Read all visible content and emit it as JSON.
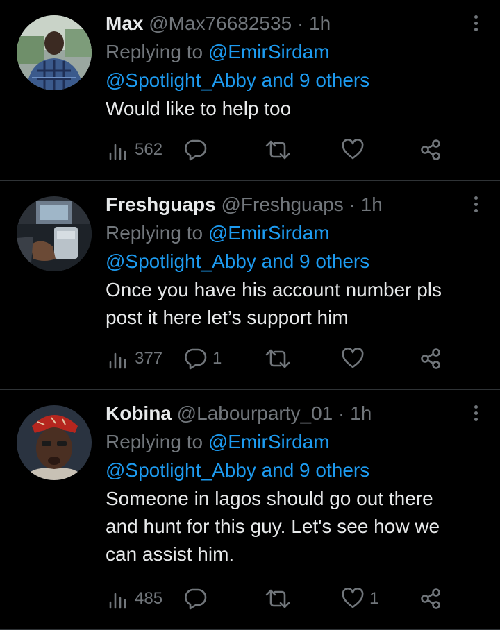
{
  "tweets": [
    {
      "name": "Max",
      "handle": "@Max76682535",
      "separator": "·",
      "time": "1h",
      "replying_prefix": "Replying to ",
      "mention_primary": "@EmirSirdam",
      "mention_secondary": "@Spotlight_Abby and 9 others",
      "text": "Would like to help too",
      "views": "562",
      "replies": "",
      "retweets": "",
      "likes": ""
    },
    {
      "name": "Freshguaps",
      "handle": "@Freshguaps",
      "separator": "·",
      "time": "1h",
      "replying_prefix": "Replying to ",
      "mention_primary": "@EmirSirdam",
      "mention_secondary": "@Spotlight_Abby and 9 others",
      "text_lines": [
        "Once you have his account number pls",
        "post it here let’s support him"
      ],
      "views": "377",
      "replies": "1",
      "retweets": "",
      "likes": ""
    },
    {
      "name": "Kobina",
      "handle": "@Labourparty_01",
      "separator": "·",
      "time": "1h",
      "replying_prefix": "Replying to ",
      "mention_primary": "@EmirSirdam",
      "mention_secondary": "@Spotlight_Abby and 9 others",
      "text_lines": [
        "Someone in lagos should go out there",
        "and hunt for this guy. Let's see how we",
        "can assist him."
      ],
      "views": "485",
      "replies": "",
      "retweets": "",
      "likes": "1"
    }
  ],
  "icons": {
    "views": "views-icon",
    "reply": "reply-icon",
    "retweet": "retweet-icon",
    "like": "heart-icon",
    "share": "share-icon",
    "more": "more-icon"
  },
  "colors": {
    "background": "#000000",
    "text": "#e7e9ea",
    "muted": "#71767b",
    "link": "#1d9bf0",
    "divider": "#2f3336"
  }
}
